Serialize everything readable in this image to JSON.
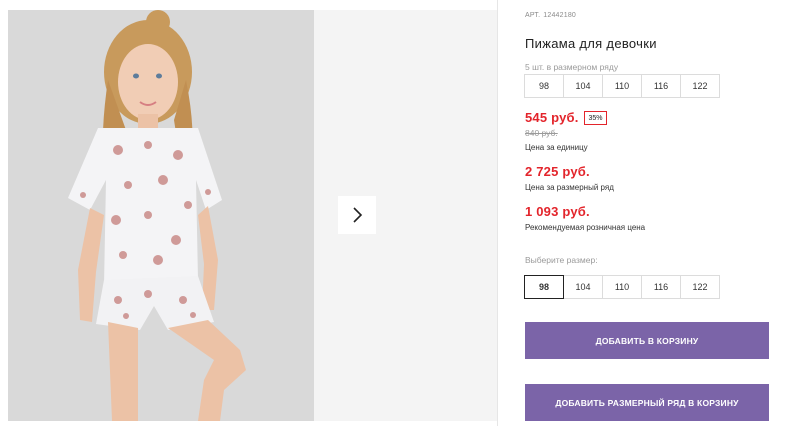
{
  "product": {
    "art_label": "АРТ.",
    "art_value": "12442180",
    "title": "Пижама для девочки",
    "pack_caption": "5 шт. в размерном ряду",
    "pack_sizes": [
      "98",
      "104",
      "110",
      "116",
      "122"
    ]
  },
  "prices": {
    "unit_price": "545 руб.",
    "discount_badge": "35%",
    "old_price": "840 руб.",
    "unit_caption": "Цена за единицу",
    "row_price": "2 725 руб.",
    "row_caption": "Цена за размерный ряд",
    "rrp_price": "1 093 руб.",
    "rrp_caption": "Рекомендуемая розничная цена",
    "accent_color": "#e3242b"
  },
  "size_select": {
    "label": "Выберите размер:",
    "options": [
      "98",
      "104",
      "110",
      "116",
      "122"
    ],
    "selected": "98"
  },
  "actions": {
    "add_to_cart": "ДОБАВИТЬ В КОРЗИНУ",
    "add_row_to_cart": "ДОБАВИТЬ РАЗМЕРНЫЙ РЯД В КОРЗИНУ",
    "button_color": "#7b64a8"
  },
  "gallery": {
    "next_icon": "chevron-right-icon"
  }
}
